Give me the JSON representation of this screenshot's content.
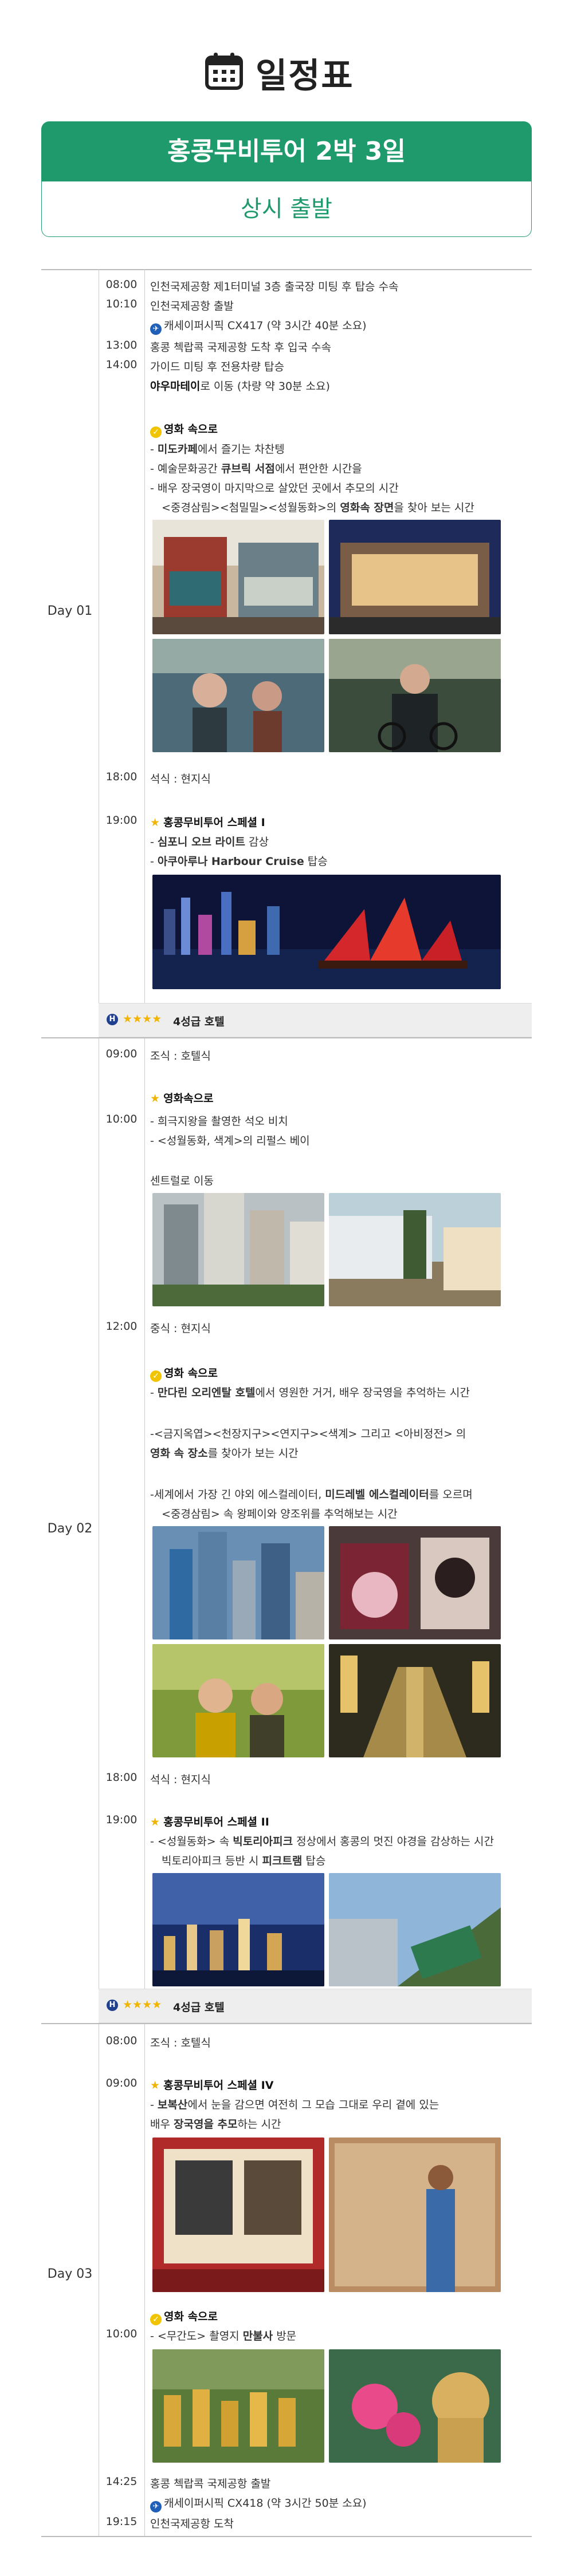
{
  "header": {
    "title": "일정표",
    "banner": "홍콩무비투어 2박 3일",
    "departure": "상시 출발"
  },
  "days": {
    "d1": "Day 01",
    "d2": "Day 02",
    "d3": "Day 03"
  },
  "d1": {
    "t1": "08:00",
    "r1": "인천국제공항 제1터미널 3층 출국장 미팅 후 탑승 수속",
    "t2": "10:10",
    "r2": "인천국제공항 출발",
    "r3": "캐세이퍼시픽 CX417 (약 3시간 40분 소요)",
    "t4": "13:00",
    "r4": "홍콩 첵랍콕 국제공항 도착 후 입국 수속",
    "t5": "14:00",
    "r5": "가이드 미팅 후 전용차량 탑승",
    "r6a": "야우마테이",
    "r6b": "로 이동 (차량 약 30분 소요)",
    "m_title": "영화 속으로",
    "m1a": "- ",
    "m1b": "미도카페",
    "m1c": "에서 즐기는 차찬텡",
    "m2a": "- 예술문화공간 ",
    "m2b": "큐브릭 서점",
    "m2c": "에서 편안한 시간을",
    "m3": "- 배우 장국영이 마지막으로 살았던 곳에서 추모의 시간",
    "m4a": "<중경삼림><첨밀밀><성월동화>의 ",
    "m4b": "영화속 장면",
    "m4c": "을 찾아 보는 시간",
    "t7": "18:00",
    "r7": "석식 : 현지식",
    "t8": "19:00",
    "sp_title": "홍콩무비투어 스페셜 I",
    "sp1a": "- ",
    "sp1b": "심포니 오브 라이트",
    "sp1c": " 감상",
    "sp2a": "- ",
    "sp2b": "아쿠아루나 Harbour Cruise",
    "sp2c": " 탑승",
    "hotel": "4성급 호텔"
  },
  "d2": {
    "t1": "09:00",
    "r1": "조식 : 호텔식",
    "t2": "10:00",
    "m_title": "영화속으로",
    "m1": "-  희극지왕을 촬영한 석오 비치",
    "m2": "-  <성월동화, 색계>의 리펄스 베이",
    "m3": "센트럴로 이동",
    "t3": "12:00",
    "r3": "중식 : 현지식",
    "m2_title": "영화 속으로",
    "n1a": "- ",
    "n1b": "만다린 오리엔탈 호텔",
    "n1c": "에서 영원한 거거, 배우 장국영을 추억하는 시간",
    "n2a": "-<금지옥엽><천장지구><연지구><색계> 그리고 <아비정전> 의",
    "n2b": "영화 속 장소",
    "n2c": "를 찾아가 보는 시간",
    "n3a": "-세계에서 가장 긴 야외 에스컬레이터, ",
    "n3b": "미드레벨 에스컬레이터",
    "n3c": "를 오르며",
    "n4": "<중경삼림> 속 왕페이와 양조위를 추억해보는 시간",
    "t4": "18:00",
    "r4": "석식 : 현지식",
    "t5": "19:00",
    "sp_title": "홍콩무비투어 스페셜 II",
    "sp1a": "- <성월동화> 속 ",
    "sp1b": "빅토리아피크",
    "sp1c": " 정상에서 홍콩의 멋진 야경을 감상하는 시간",
    "sp2a": "빅토리아피크 등반 시 ",
    "sp2b": "피크트램",
    "sp2c": " 탑승",
    "hotel": "4성급 호텔"
  },
  "d3": {
    "t1": "08:00",
    "r1": "조식 : 호텔식",
    "t2": "09:00",
    "sp_title": "홍콩무비투어 스페셜 IV",
    "sp1a": "- ",
    "sp1b": "보복산",
    "sp1c": "에서 눈을 감으면 여전히 그 모습 그대로 우리 곁에 있는",
    "sp2a": "배우 ",
    "sp2b": "장국영을 추모",
    "sp2c": "하는 시간",
    "t3": "10:00",
    "m_title": "영화 속으로",
    "m1a": "- <무간도> 촬영지 ",
    "m1b": "만불사",
    "m1c": " 방문",
    "t4": "14:25",
    "r4": "홍콩 첵랍콕 국제공항 출발",
    "r5": "캐세이퍼시픽 CX418 (약 3시간 50분 소요)",
    "t6": "19:15",
    "r6": "인천국제공항 도착"
  },
  "colors": {
    "accent": "#1e9a6d",
    "star": "#f1b400",
    "airline": "#1f5fb7"
  }
}
